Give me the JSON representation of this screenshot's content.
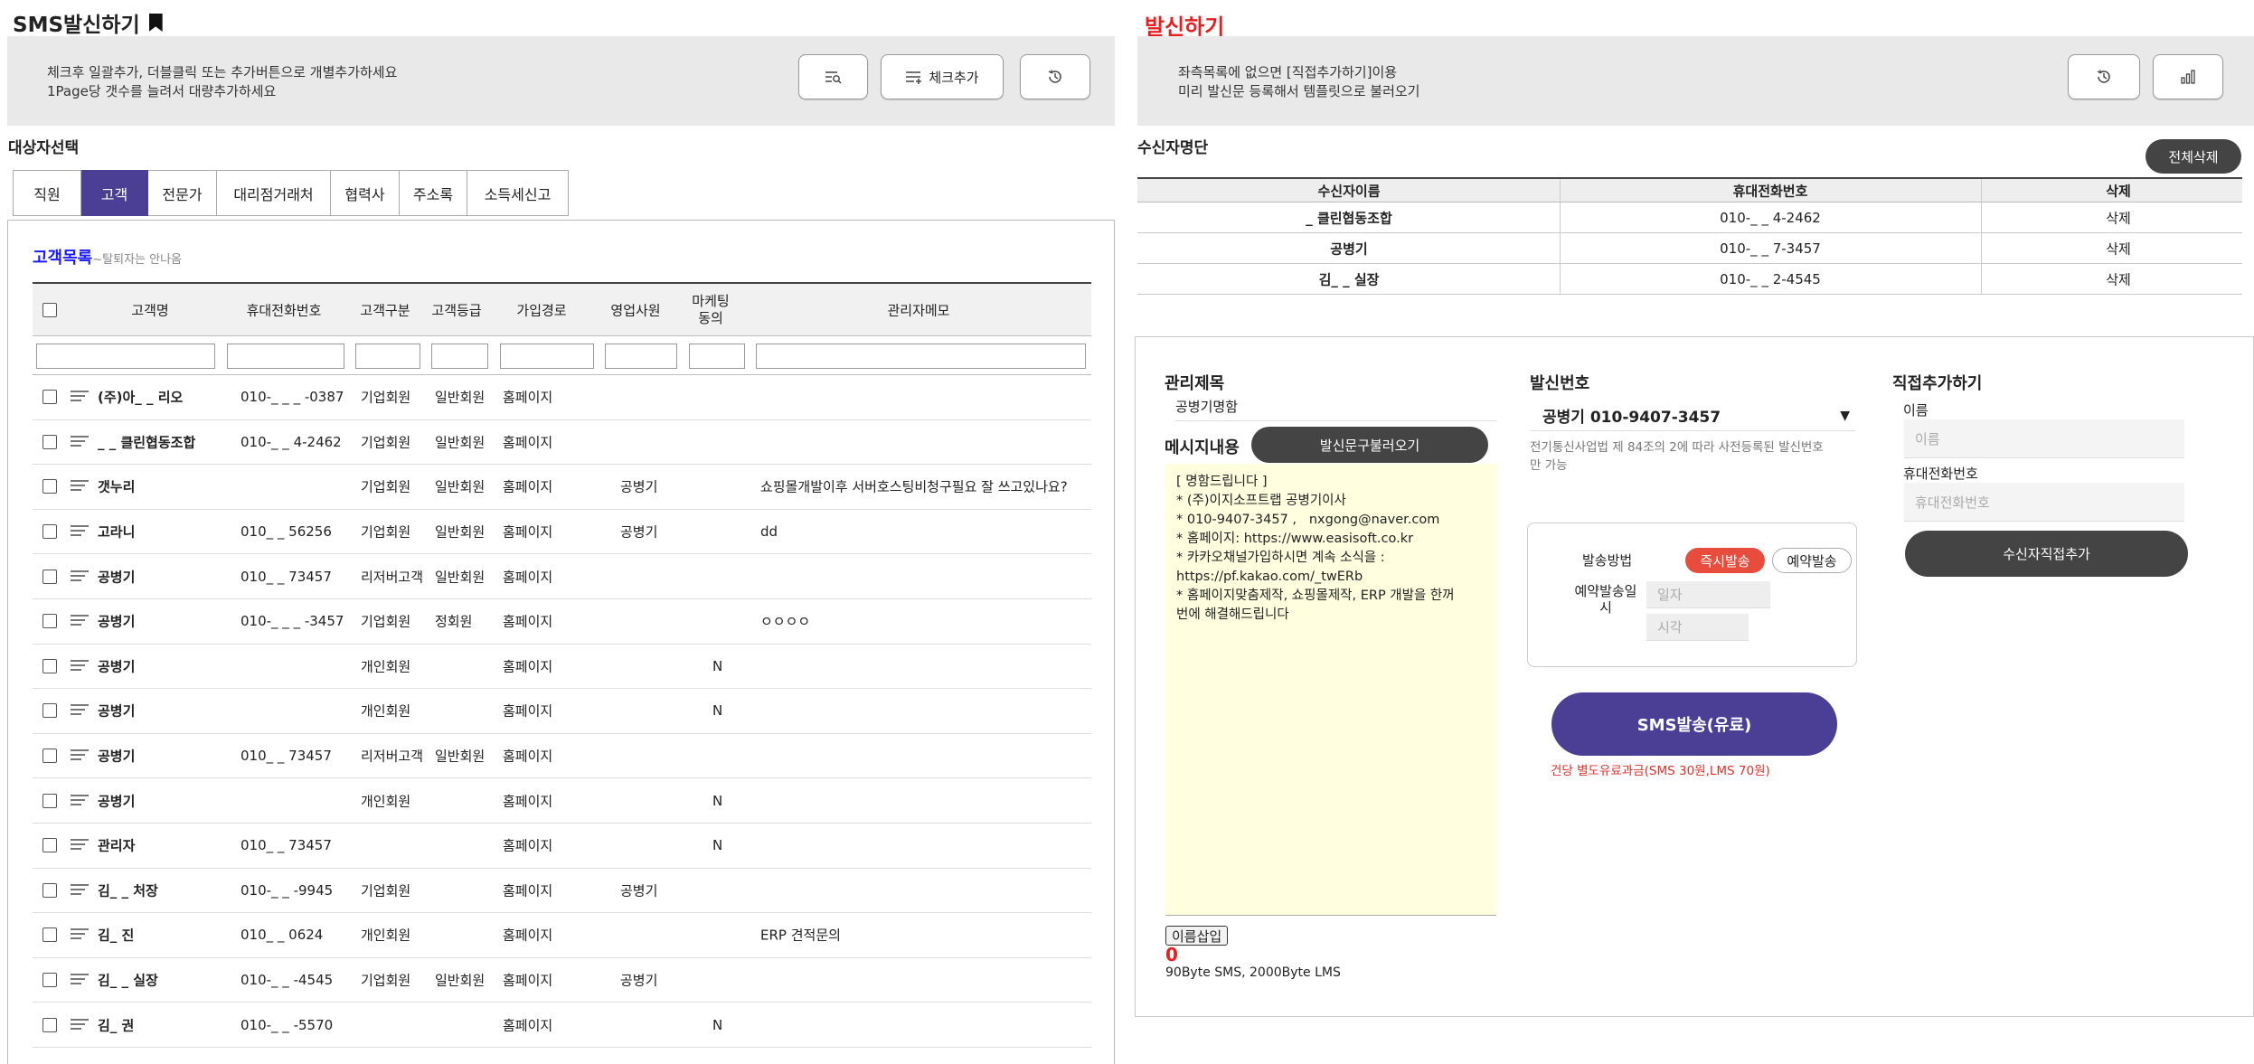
{
  "left": {
    "title": "SMS발신하기",
    "info_line1": "체크후 일괄추가, 더블클릭 또는 추가버튼으로 개별추가하세요",
    "info_line2": "1Page당 갯수를 늘려서 대량추가하세요",
    "btn_check_add": "체크추가",
    "section_title": "대상자선택",
    "tabs": [
      "직원",
      "고객",
      "전문가",
      "대리점거래처",
      "협력사",
      "주소록",
      "소득세신고"
    ],
    "active_tab": "고객",
    "list_title": "고객목록",
    "list_subtitle": "~탈퇴자는 안나옴",
    "columns": [
      "고객명",
      "휴대전화번호",
      "고객구분",
      "고객등급",
      "가입경로",
      "영업사원",
      "마케팅\n동의",
      "관리자메모"
    ],
    "rows": [
      {
        "name": "(주)아_ _ 리오",
        "phone": "010-_ _ _ -0387",
        "type": "기업회원",
        "grade": "일반회원",
        "path": "홈페이지",
        "sales": "",
        "mkt": "",
        "memo": ""
      },
      {
        "name": "_ _ 클린협동조합",
        "phone": "010-_ _ 4-2462",
        "type": "기업회원",
        "grade": "일반회원",
        "path": "홈페이지",
        "sales": "",
        "mkt": "",
        "memo": ""
      },
      {
        "name": "갯누리",
        "phone": "",
        "type": "기업회원",
        "grade": "일반회원",
        "path": "홈페이지",
        "sales": "공병기",
        "mkt": "",
        "memo": "쇼핑몰개발이후 서버호스팅비청구필요 잘 쓰고있나요?"
      },
      {
        "name": "고라니",
        "phone": "010_ _ 56256",
        "type": "기업회원",
        "grade": "일반회원",
        "path": "홈페이지",
        "sales": "공병기",
        "mkt": "",
        "memo": "dd"
      },
      {
        "name": "공병기",
        "phone": "010_ _ 73457",
        "type": "리저버고객",
        "grade": "일반회원",
        "path": "홈페이지",
        "sales": "",
        "mkt": "",
        "memo": ""
      },
      {
        "name": "공병기",
        "phone": "010-_ _ _ -3457",
        "type": "기업회원",
        "grade": "정회원",
        "path": "홈페이지",
        "sales": "",
        "mkt": "",
        "memo": "ㅇㅇㅇㅇ"
      },
      {
        "name": "공병기",
        "phone": "",
        "type": "개인회원",
        "grade": "",
        "path": "홈페이지",
        "sales": "",
        "mkt": "N",
        "memo": ""
      },
      {
        "name": "공병기",
        "phone": "",
        "type": "개인회원",
        "grade": "",
        "path": "홈페이지",
        "sales": "",
        "mkt": "N",
        "memo": ""
      },
      {
        "name": "공병기",
        "phone": "010_ _ 73457",
        "type": "리저버고객",
        "grade": "일반회원",
        "path": "홈페이지",
        "sales": "",
        "mkt": "",
        "memo": ""
      },
      {
        "name": "공병기",
        "phone": "",
        "type": "개인회원",
        "grade": "",
        "path": "홈페이지",
        "sales": "",
        "mkt": "N",
        "memo": ""
      },
      {
        "name": "관리자",
        "phone": "010_ _ 73457",
        "type": "",
        "grade": "",
        "path": "홈페이지",
        "sales": "",
        "mkt": "N",
        "memo": ""
      },
      {
        "name": "김_ _ 처장",
        "phone": "010-_ _ -9945",
        "type": "기업회원",
        "grade": "",
        "path": "홈페이지",
        "sales": "공병기",
        "mkt": "",
        "memo": ""
      },
      {
        "name": "김_ 진",
        "phone": "010_ _ 0624",
        "type": "개인회원",
        "grade": "",
        "path": "홈페이지",
        "sales": "",
        "mkt": "",
        "memo": "ERP 견적문의"
      },
      {
        "name": "김_ _ 실장",
        "phone": "010-_ _ -4545",
        "type": "기업회원",
        "grade": "일반회원",
        "path": "홈페이지",
        "sales": "공병기",
        "mkt": "",
        "memo": ""
      },
      {
        "name": "김_ 권",
        "phone": "010-_ _ -5570",
        "type": "",
        "grade": "",
        "path": "홈페이지",
        "sales": "",
        "mkt": "N",
        "memo": ""
      }
    ]
  },
  "right": {
    "title": "발신하기",
    "info_line1": "좌측목록에 없으면 [직접추가하기]이용",
    "info_line2": "미리 발신문 등록해서 템플릿으로 불러오기",
    "recipients_title": "수신자명단",
    "delete_all": "전체삭제",
    "rcols": [
      "수신자이름",
      "휴대전화번호",
      "삭제"
    ],
    "recipients": [
      {
        "name": "_ 클린협동조합",
        "phone": "010-_ _ 4-2462",
        "del": "삭제"
      },
      {
        "name": "공병기",
        "phone": "010-_ _ 7-3457",
        "del": "삭제"
      },
      {
        "name": "김_ _ 실장",
        "phone": "010-_ _ 2-4545",
        "del": "삭제"
      }
    ],
    "mgmt_title_label": "관리제목",
    "mgmt_title_value": "공병기명함",
    "msg_label": "메시지내용",
    "load_btn": "발신문구불러오기",
    "message": "[ 명함드립니다 ]\n* (주)이지소프트랩 공병기이사\n* 010-9407-3457 ,   nxgong@naver.com\n* 홈페이지: https://www.easisoft.co.kr\n* 카카오채널가입하시면 계속 소식을 :\nhttps://pf.kakao.com/_twERb\n* 홈페이지맞춤제작, 쇼핑몰제작, ERP 개발을 한꺼\n번에 해결해드립니다",
    "insert_name": "이름삽입",
    "byte_count": "0",
    "byte_info": "90Byte SMS, 2000Byte LMS",
    "sender_label": "발신번호",
    "sender_value": "공병기 010-9407-3457",
    "sender_note1": "전기통신사업법 제 84조의 2에 따라 사전등록된 발신번호",
    "sender_note2": "만 가능",
    "send_method_label": "발송방법",
    "btn_now": "즉시발송",
    "btn_reserve": "예약발송",
    "reserve_label1": "예약발송일",
    "reserve_label2": "시",
    "date_placeholder": "일자",
    "time_placeholder": "시각",
    "send_btn": "SMS발송(유료)",
    "fee_note": "건당  별도유료과금(SMS 30원,LMS 70원)",
    "direct_title": "직접추가하기",
    "name_label": "이름",
    "name_placeholder": "이름",
    "phone_label": "휴대전화번호",
    "phone_placeholder": "휴대전화번호",
    "direct_add_btn": "수신자직접추가"
  },
  "colors": {
    "accent": "#4b3f95",
    "red": "#e62020",
    "dark": "#444444",
    "note": "#e0302a"
  }
}
